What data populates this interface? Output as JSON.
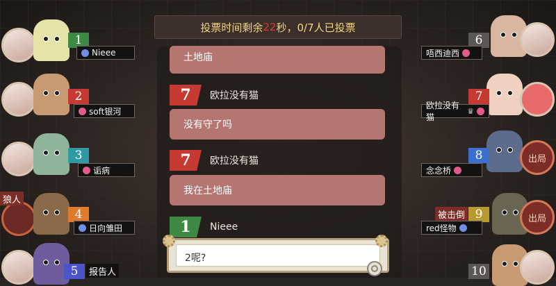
{
  "vote_banner": {
    "prefix": "投票时间剩余",
    "seconds": "22",
    "suffix": "秒，0/7人已投票"
  },
  "chat": {
    "partial_message": "土地庙",
    "messages": [
      {
        "seat": "7",
        "name": "欧拉没有猫",
        "text": "没有守了吗",
        "color": "red"
      },
      {
        "seat": "7",
        "name": "欧拉没有猫",
        "text": "我在土地庙",
        "color": "red"
      },
      {
        "seat": "1",
        "name": "Nieee",
        "text": "",
        "color": "green"
      }
    ],
    "input_value": "2呢?"
  },
  "players_left": [
    {
      "seat": "1",
      "name": "Nieee",
      "gender": "male",
      "seat_color": "#3e8a44",
      "tag": ""
    },
    {
      "seat": "2",
      "name": "soft银河",
      "gender": "female",
      "seat_color": "#c73a34",
      "tag": ""
    },
    {
      "seat": "3",
      "name": "诟病",
      "gender": "female",
      "seat_color": "#2f9aa6",
      "tag": ""
    },
    {
      "seat": "4",
      "name": "日向雏田",
      "gender": "male",
      "seat_color": "#e07a2c",
      "tag": "狼人"
    },
    {
      "seat": "5",
      "name": "",
      "gender": "",
      "seat_color": "#4b55c9",
      "tag": "报告人"
    }
  ],
  "players_right": [
    {
      "seat": "6",
      "name": "唔西迪西",
      "gender": "female",
      "seat_color": "#5b5753",
      "tag": ""
    },
    {
      "seat": "7",
      "name": "欧拉没有猫",
      "gender": "female",
      "seat_color": "#c73a34",
      "tag": "",
      "crown": "♛"
    },
    {
      "seat": "8",
      "name": "念念桥",
      "gender": "female",
      "seat_color": "#3b6fd0",
      "tag": "出局"
    },
    {
      "seat": "9",
      "name": "red怪物",
      "gender": "male",
      "seat_color": "#b59a2f",
      "tag": "出局",
      "tag_left": "被击倒"
    },
    {
      "seat": "10",
      "name": "",
      "gender": "",
      "seat_color": "#5b5753",
      "tag": ""
    }
  ]
}
